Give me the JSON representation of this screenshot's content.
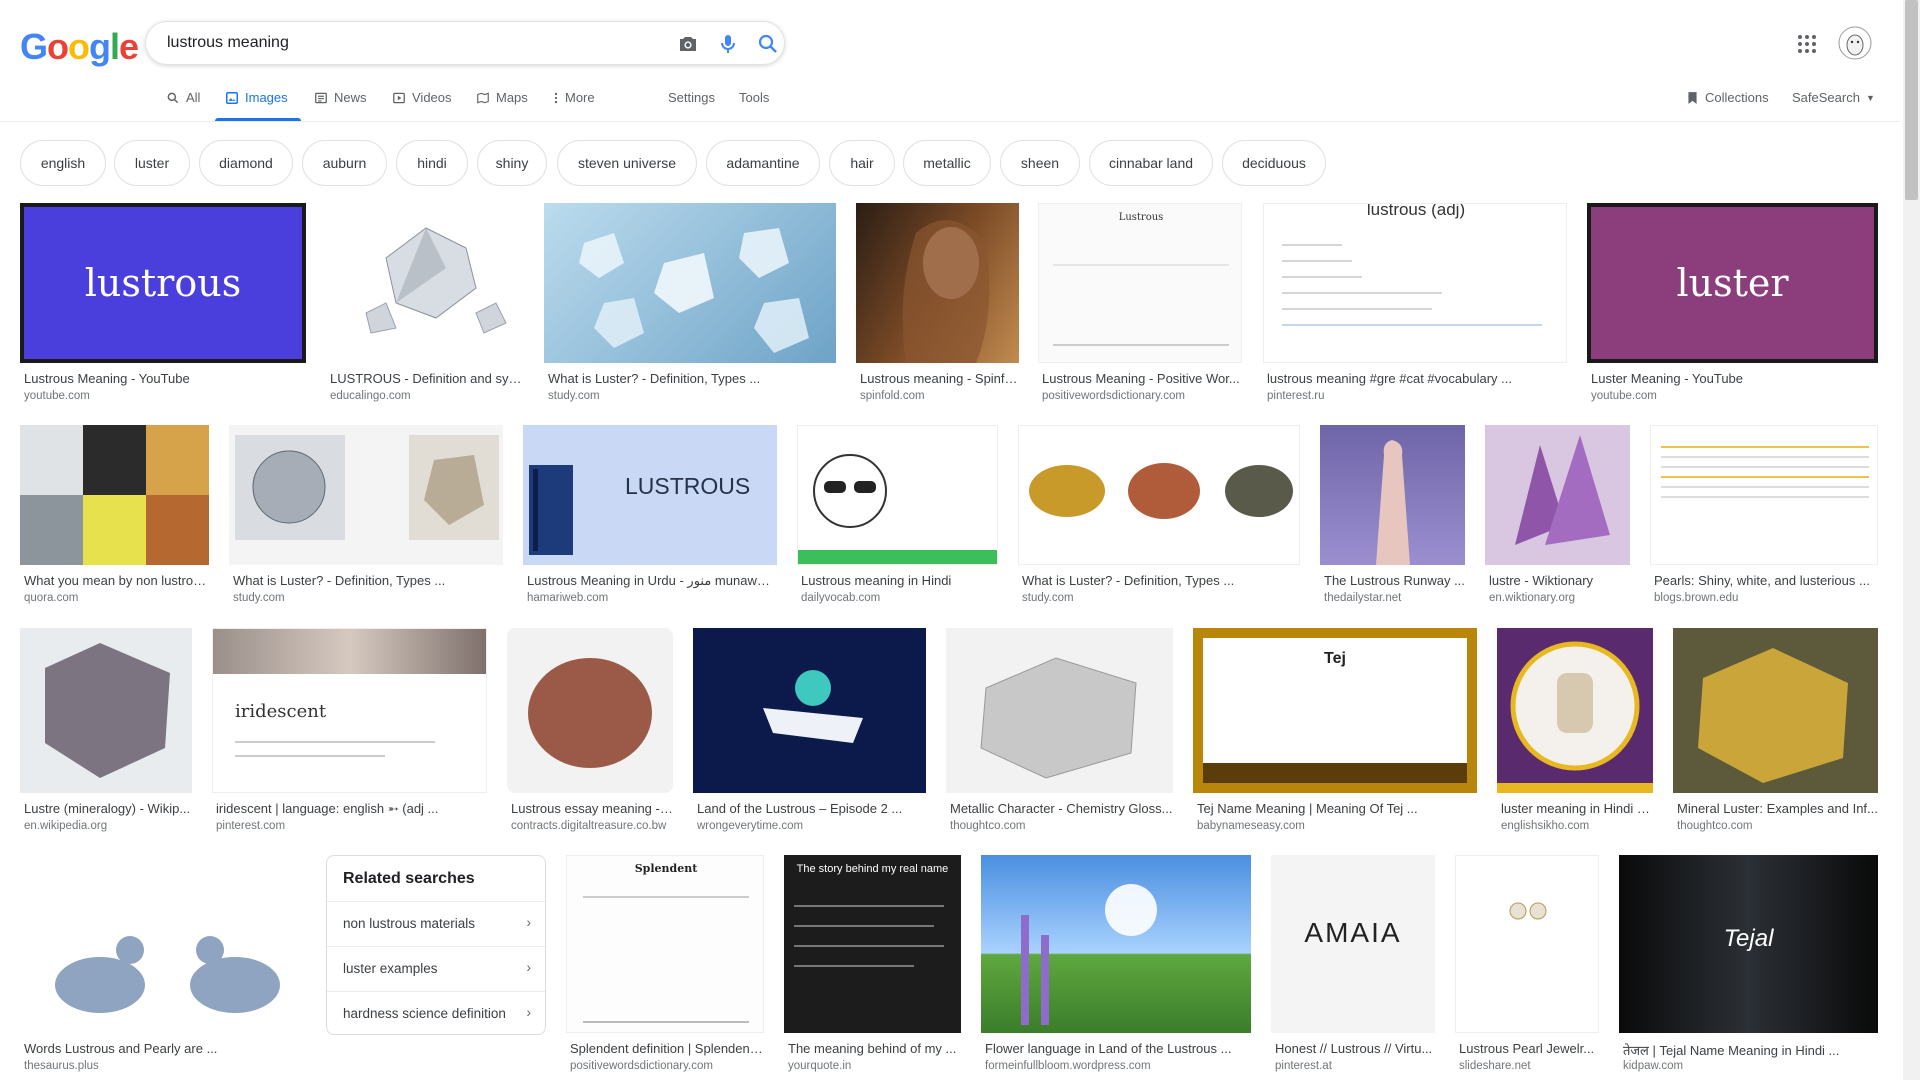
{
  "logo": "Google",
  "logo_colors": [
    "#4285F4",
    "#EA4335",
    "#FBBC05",
    "#4285F4",
    "#34A853",
    "#EA4335"
  ],
  "search": {
    "query": "lustrous meaning"
  },
  "nav": {
    "tabs": [
      {
        "label": "All",
        "icon": "search-icon"
      },
      {
        "label": "Images",
        "icon": "image-icon"
      },
      {
        "label": "News",
        "icon": "news-icon"
      },
      {
        "label": "Videos",
        "icon": "video-icon"
      },
      {
        "label": "Maps",
        "icon": "map-icon"
      },
      {
        "label": "More",
        "icon": "more-vert-icon"
      }
    ],
    "settings": "Settings",
    "tools": "Tools",
    "collections": "Collections",
    "safesearch": "SafeSearch"
  },
  "chips": [
    "english",
    "luster",
    "diamond",
    "auburn",
    "hindi",
    "shiny",
    "steven universe",
    "adamantine",
    "hair",
    "metallic",
    "sheen",
    "cinnabar land",
    "deciduous"
  ],
  "results": [
    {
      "title": "Lustrous Meaning - YouTube",
      "source": "youtube.com",
      "thumb_text": "lustrous"
    },
    {
      "title": "LUSTROUS - Definition and syn...",
      "source": "educalingo.com"
    },
    {
      "title": "What is Luster? - Definition, Types ...",
      "source": "study.com"
    },
    {
      "title": "Lustrous meaning - Spinfold",
      "source": "spinfold.com"
    },
    {
      "title": "Lustrous Meaning - Positive Wor...",
      "source": "positivewordsdictionary.com",
      "thumb_text": "Lustrous"
    },
    {
      "title": "lustrous meaning #gre #cat #vocabulary ...",
      "source": "pinterest.ru",
      "thumb_text": "lustrous (adj)"
    },
    {
      "title": "Luster Meaning - YouTube",
      "source": "youtube.com",
      "thumb_text": "luster"
    },
    {
      "title": "What you mean by non lustrou...",
      "source": "quora.com"
    },
    {
      "title": "What is Luster? - Definition, Types ...",
      "source": "study.com"
    },
    {
      "title": "Lustrous Meaning in Urdu - منور munawar ...",
      "source": "hamariweb.com",
      "thumb_text": "LUSTROUS"
    },
    {
      "title": "Lustrous meaning in Hindi",
      "source": "dailyvocab.com"
    },
    {
      "title": "What is Luster? - Definition, Types ...",
      "source": "study.com"
    },
    {
      "title": "The Lustrous Runway ...",
      "source": "thedailystar.net"
    },
    {
      "title": "lustre - Wiktionary",
      "source": "en.wiktionary.org"
    },
    {
      "title": "Pearls: Shiny, white, and lusterious ...",
      "source": "blogs.brown.edu"
    },
    {
      "title": "Lustre (mineralogy) - Wikip...",
      "source": "en.wikipedia.org"
    },
    {
      "title": "iridescent | language: english ➵ (adj ...",
      "source": "pinterest.com",
      "thumb_text": "iridescent"
    },
    {
      "title": "Lustrous essay meaning - ...",
      "source": "contracts.digitaltreasure.co.bw"
    },
    {
      "title": "Land of the Lustrous – Episode 2 ...",
      "source": "wrongeverytime.com"
    },
    {
      "title": "Metallic Character - Chemistry Gloss...",
      "source": "thoughtco.com"
    },
    {
      "title": "Tej Name Meaning | Meaning Of Tej ...",
      "source": "babynameseasy.com",
      "thumb_text": "Tej"
    },
    {
      "title": "luster meaning in Hindi - ...",
      "source": "englishsikho.com"
    },
    {
      "title": "Mineral Luster: Examples and Inf...",
      "source": "thoughtco.com"
    },
    {
      "title": "Words Lustrous and Pearly are ...",
      "source": "thesaurus.plus"
    },
    {
      "title": "Splendent definition | Splendent...",
      "source": "positivewordsdictionary.com",
      "thumb_text": "Splendent"
    },
    {
      "title": "The meaning behind of my ...",
      "source": "yourquote.in",
      "thumb_text": "The story behind my real name"
    },
    {
      "title": "Flower language in Land of the Lustrous ...",
      "source": "formeinfullbloom.wordpress.com"
    },
    {
      "title": "Honest // Lustrous // Virtu...",
      "source": "pinterest.at",
      "thumb_text": "AMAIA"
    },
    {
      "title": "Lustrous Pearl Jewelr...",
      "source": "slideshare.net"
    },
    {
      "title": "तेजल | Tejal Name Meaning in Hindi ...",
      "source": "kidpaw.com",
      "thumb_text": "Tejal"
    }
  ],
  "related": {
    "title": "Related searches",
    "items": [
      "non lustrous materials",
      "luster examples",
      "hardness science definition"
    ]
  },
  "colors": {
    "accent": "#1a73e8",
    "border": "#dfe1e5"
  }
}
